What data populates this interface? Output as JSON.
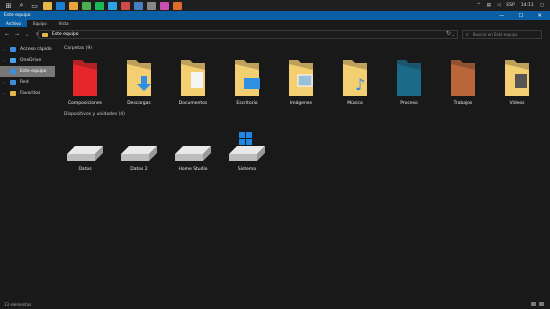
{
  "taskbar": {
    "start_icon": "windows-logo-icon",
    "apps": [
      {
        "name": "explorer",
        "color": "#e6b84a"
      },
      {
        "name": "edge",
        "color": "#1b7fd6"
      },
      {
        "name": "chrome",
        "color": "#e8a33a"
      },
      {
        "name": "browser",
        "color": "#4caf50"
      },
      {
        "name": "spotify",
        "color": "#1db954"
      },
      {
        "name": "photoshop",
        "color": "#2fa3e6"
      },
      {
        "name": "app7",
        "color": "#d04a4a"
      },
      {
        "name": "steam",
        "color": "#4a7fbf"
      },
      {
        "name": "app9",
        "color": "#888888"
      },
      {
        "name": "app10",
        "color": "#c94fb0"
      },
      {
        "name": "app11",
        "color": "#e06b2a"
      }
    ],
    "language": "ESP",
    "time": "14:11"
  },
  "window": {
    "title": "Este equipo",
    "controls": [
      "—",
      "☐",
      "✕"
    ]
  },
  "ribbon": {
    "tabs": [
      "Archivo",
      "Equipo",
      "Vista"
    ]
  },
  "address": {
    "path": "Este equipo",
    "search_placeholder": "Buscar en Este equipo"
  },
  "sidebar": {
    "items": [
      {
        "label": "Acceso rápido",
        "icon_color": "#3b8de0"
      },
      {
        "label": "OneDrive",
        "icon_color": "#4aa3f0"
      },
      {
        "label": "Este equipo",
        "icon_color": "#3b8de0"
      },
      {
        "label": "Red",
        "icon_color": "#3b8de0"
      },
      {
        "label": "Favoritos",
        "icon_color": "#e6b84a"
      }
    ]
  },
  "folders_section": "Carpetas (9)",
  "folders": [
    {
      "label": "Composiciones",
      "color": "#e6262a"
    },
    {
      "label": "Descargas",
      "color": "#f4cf72"
    },
    {
      "label": "Documentos",
      "color": "#f4cf72"
    },
    {
      "label": "Escritorio",
      "color": "#f4cf72"
    },
    {
      "label": "Imágenes",
      "color": "#f4cf72"
    },
    {
      "label": "Música",
      "color": "#f4cf72"
    },
    {
      "label": "Proceso",
      "color": "#1b6a87"
    },
    {
      "label": "Trabajos",
      "color": "#b8663a"
    },
    {
      "label": "Vídeos",
      "color": "#f4cf72"
    }
  ],
  "drives_section": "Dispositivos y unidades (4)",
  "drives": [
    {
      "label": "Datos"
    },
    {
      "label": "Datos 2"
    },
    {
      "label": "Home Studio"
    },
    {
      "label": "Sistema"
    }
  ],
  "status": {
    "count": "13 elementos"
  }
}
